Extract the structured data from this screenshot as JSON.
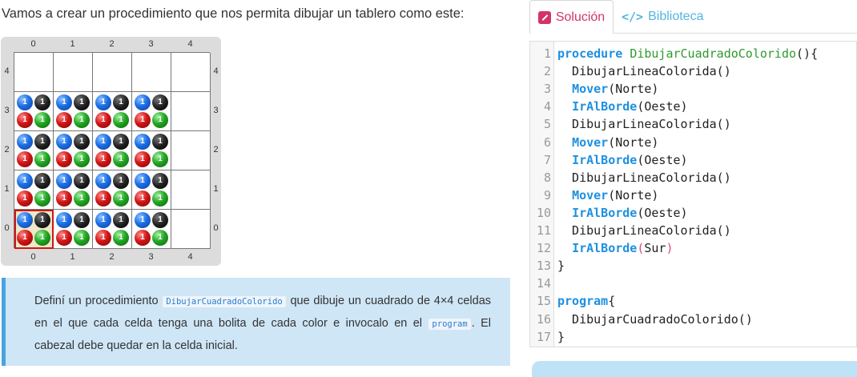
{
  "intro": "Vamos a crear un procedimiento que nos permita dibujar un tablero como este:",
  "board": {
    "columns": [
      "0",
      "1",
      "2",
      "3",
      "4"
    ],
    "rows": [
      "4",
      "3",
      "2",
      "1",
      "0"
    ],
    "ball_count": "1",
    "colors": {
      "azul": "#1d6fe6",
      "negro": "#222222",
      "rojo": "#d11616",
      "verde": "#23a823",
      "head": "#d21414"
    }
  },
  "info": {
    "t1": "Definí un procedimiento ",
    "c1": "DibujarCuadradoColorido",
    "t2": " que dibuje un cuadrado de 4×4 celdas en el que cada celda tenga una bolita de cada color e invocalo en el ",
    "c2": "program",
    "t3": ". El cabezal debe quedar en la celda inicial."
  },
  "tabs": {
    "solucion": "Solución",
    "biblioteca": "Biblioteca",
    "biblioteca_icon": "</>"
  },
  "editor": {
    "lines": [
      {
        "n": "1",
        "kw": "procedure",
        "rest_name": "DibujarCuadradoColorido",
        "tail": "(){"
      },
      {
        "n": "2",
        "text": "  DibujarLineaColorida()"
      },
      {
        "n": "3",
        "cmd": "Mover",
        "arg": "(Norte)"
      },
      {
        "n": "4",
        "cmd": "IrAlBorde",
        "arg": "(Oeste)"
      },
      {
        "n": "5",
        "text": "  DibujarLineaColorida()"
      },
      {
        "n": "6",
        "cmd": "Mover",
        "arg": "(Norte)"
      },
      {
        "n": "7",
        "cmd": "IrAlBorde",
        "arg": "(Oeste)"
      },
      {
        "n": "8",
        "text": "  DibujarLineaColorida()"
      },
      {
        "n": "9",
        "cmd": "Mover",
        "arg": "(Norte)"
      },
      {
        "n": "10",
        "cmd": "IrAlBorde",
        "arg": "(Oeste)"
      },
      {
        "n": "11",
        "text": "  DibujarLineaColorida()"
      },
      {
        "n": "12",
        "cmd": "IrAlBorde",
        "arg": "(Sur)"
      },
      {
        "n": "13",
        "text": "}"
      },
      {
        "n": "14",
        "text": ""
      },
      {
        "n": "15",
        "kw": "program",
        "tail": "{"
      },
      {
        "n": "16",
        "text": "  DibujarCuadradoColorido()"
      },
      {
        "n": "17",
        "text": "}"
      }
    ]
  }
}
